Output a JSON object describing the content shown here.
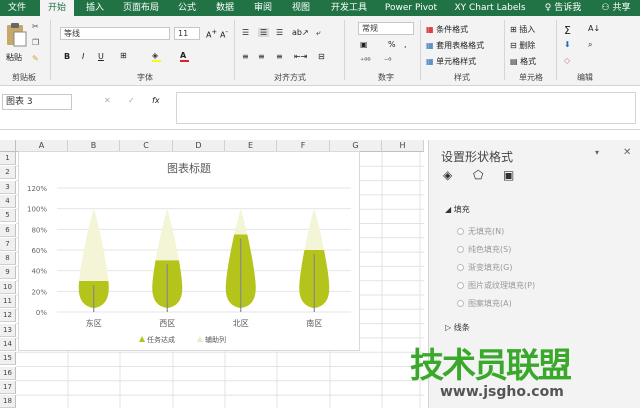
{
  "ribbon_tabs": [
    "文件",
    "开始",
    "插入",
    "页面布局",
    "公式",
    "数据",
    "审阅",
    "视图",
    "开发工具",
    "Power Pivot",
    "XY Chart Labels"
  ],
  "tell_me": "告诉我",
  "share": "共享",
  "clipboard": {
    "paste": "粘贴",
    "label": "剪贴板"
  },
  "font": {
    "name": "等线",
    "size": "11",
    "bold": "B",
    "italic": "I",
    "underline": "U",
    "label": "字体"
  },
  "alignment": {
    "label": "对齐方式"
  },
  "number": {
    "format": "常规",
    "percent": "%",
    "comma": ",",
    "label": "数字"
  },
  "styles": {
    "conditional": "条件格式",
    "table": "套用表格格式",
    "cell": "单元格样式",
    "label": "样式"
  },
  "cells": {
    "insert": "插入",
    "delete": "删除",
    "format": "格式",
    "label": "单元格"
  },
  "editing": {
    "label": "编辑"
  },
  "name_box": "图表 3",
  "fx": "fx",
  "columns": [
    "A",
    "B",
    "C",
    "D",
    "E",
    "F",
    "G",
    "H"
  ],
  "rows": [
    "1",
    "2",
    "3",
    "4",
    "5",
    "6",
    "7",
    "8",
    "9",
    "10",
    "11",
    "12",
    "13",
    "14",
    "15",
    "16",
    "17",
    "18"
  ],
  "chart_data": {
    "type": "bar",
    "title": "图表标题",
    "categories": [
      "东区",
      "西区",
      "北区",
      "南区"
    ],
    "series": [
      {
        "name": "任务达成",
        "values": [
          30,
          50,
          75,
          60
        ],
        "color": "#b5c41a"
      },
      {
        "name": "辅助列",
        "values": [
          100,
          100,
          100,
          100
        ],
        "color": "#f3f5d6"
      }
    ],
    "yticks": [
      "0%",
      "20%",
      "40%",
      "60%",
      "80%",
      "100%",
      "120%"
    ],
    "ylim": [
      0,
      120
    ],
    "legend": "bottom"
  },
  "pane": {
    "title": "设置形状格式",
    "fill_section": "填充",
    "options": [
      "无填充(N)",
      "纯色填充(S)",
      "渐变填充(G)",
      "图片或纹理填充(P)",
      "图案填充(A)"
    ],
    "line_section": "线条"
  },
  "watermark": {
    "text": "技术员联盟",
    "url": "www.jsgho.com"
  }
}
